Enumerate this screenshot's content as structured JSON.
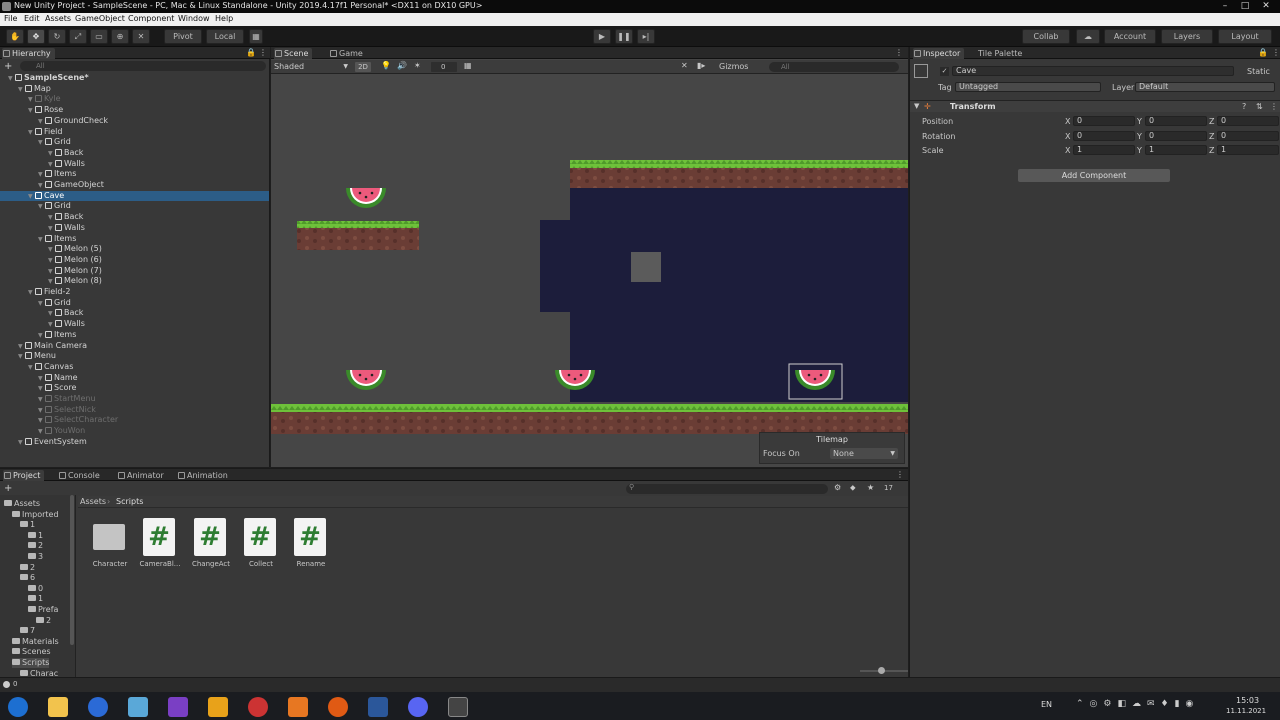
{
  "window": {
    "title": "New Unity Project - SampleScene - PC, Mac & Linux Standalone - Unity 2019.4.17f1 Personal* <DX11 on DX10 GPU>"
  },
  "menu": [
    "File",
    "Edit",
    "Assets",
    "GameObject",
    "Component",
    "Window",
    "Help"
  ],
  "toolbar": {
    "pivot": "Pivot",
    "local": "Local",
    "collab": "Collab",
    "account": "Account",
    "layers": "Layers",
    "layout": "Layout"
  },
  "hierarchy": {
    "tab": "Hierarchy",
    "search_placeholder": "All",
    "rows": [
      {
        "label": "SampleScene*",
        "indent": 0,
        "state": "root"
      },
      {
        "label": "Map",
        "indent": 1,
        "state": ""
      },
      {
        "label": "Kyle",
        "indent": 2,
        "state": "dim"
      },
      {
        "label": "Rose",
        "indent": 2,
        "state": ""
      },
      {
        "label": "GroundCheck",
        "indent": 3,
        "state": ""
      },
      {
        "label": "Field",
        "indent": 2,
        "state": ""
      },
      {
        "label": "Grid",
        "indent": 3,
        "state": ""
      },
      {
        "label": "Back",
        "indent": 4,
        "state": ""
      },
      {
        "label": "Walls",
        "indent": 4,
        "state": ""
      },
      {
        "label": "Items",
        "indent": 3,
        "state": ""
      },
      {
        "label": "GameObject",
        "indent": 3,
        "state": ""
      },
      {
        "label": "Cave",
        "indent": 2,
        "state": "sel"
      },
      {
        "label": "Grid",
        "indent": 3,
        "state": ""
      },
      {
        "label": "Back",
        "indent": 4,
        "state": ""
      },
      {
        "label": "Walls",
        "indent": 4,
        "state": ""
      },
      {
        "label": "Items",
        "indent": 3,
        "state": ""
      },
      {
        "label": "Melon (5)",
        "indent": 4,
        "state": ""
      },
      {
        "label": "Melon (6)",
        "indent": 4,
        "state": ""
      },
      {
        "label": "Melon (7)",
        "indent": 4,
        "state": ""
      },
      {
        "label": "Melon (8)",
        "indent": 4,
        "state": ""
      },
      {
        "label": "Field-2",
        "indent": 2,
        "state": ""
      },
      {
        "label": "Grid",
        "indent": 3,
        "state": ""
      },
      {
        "label": "Back",
        "indent": 4,
        "state": ""
      },
      {
        "label": "Walls",
        "indent": 4,
        "state": ""
      },
      {
        "label": "Items",
        "indent": 3,
        "state": ""
      },
      {
        "label": "Main Camera",
        "indent": 1,
        "state": ""
      },
      {
        "label": "Menu",
        "indent": 1,
        "state": ""
      },
      {
        "label": "Canvas",
        "indent": 2,
        "state": ""
      },
      {
        "label": "Name",
        "indent": 3,
        "state": ""
      },
      {
        "label": "Score",
        "indent": 3,
        "state": ""
      },
      {
        "label": "StartMenu",
        "indent": 3,
        "state": "dim"
      },
      {
        "label": "SelectNick",
        "indent": 3,
        "state": "dim"
      },
      {
        "label": "SelectCharacter",
        "indent": 3,
        "state": "dim"
      },
      {
        "label": "YouWon",
        "indent": 3,
        "state": "dim"
      },
      {
        "label": "EventSystem",
        "indent": 1,
        "state": ""
      }
    ]
  },
  "scene": {
    "tabs": [
      "Scene",
      "Game"
    ],
    "shading": "Shaded",
    "mode_2d": "2D",
    "fx_count": "0",
    "gizmos": "Gizmos",
    "search_placeholder": "All",
    "overlay": {
      "title": "Tilemap",
      "focus_label": "Focus On",
      "focus_value": "None"
    }
  },
  "inspector": {
    "tabs": [
      "Inspector",
      "Tile Palette"
    ],
    "object_name": "Cave",
    "static_label": "Static",
    "tag_label": "Tag",
    "tag_value": "Untagged",
    "layer_label": "Layer",
    "layer_value": "Default",
    "component": "Transform",
    "position": {
      "label": "Position",
      "x": "0",
      "y": "0",
      "z": "0"
    },
    "rotation": {
      "label": "Rotation",
      "x": "0",
      "y": "0",
      "z": "0"
    },
    "scale": {
      "label": "Scale",
      "x": "1",
      "y": "1",
      "z": "1"
    },
    "axis": {
      "x": "X",
      "y": "Y",
      "z": "Z"
    },
    "add_component": "Add Component"
  },
  "project": {
    "tabs": [
      "Project",
      "Console",
      "Animator",
      "Animation"
    ],
    "breadcrumb": {
      "root": "Assets",
      "current": "Scripts"
    },
    "item_count": "17",
    "tree": [
      {
        "label": "Assets",
        "indent": 0
      },
      {
        "label": "Imported",
        "indent": 1
      },
      {
        "label": "1",
        "indent": 2
      },
      {
        "label": "1",
        "indent": 3
      },
      {
        "label": "2",
        "indent": 3
      },
      {
        "label": "3",
        "indent": 3
      },
      {
        "label": "2",
        "indent": 2
      },
      {
        "label": "6",
        "indent": 2
      },
      {
        "label": "0",
        "indent": 3
      },
      {
        "label": "1",
        "indent": 3
      },
      {
        "label": "Prefa",
        "indent": 3
      },
      {
        "label": "2",
        "indent": 4
      },
      {
        "label": "7",
        "indent": 2
      },
      {
        "label": "Materials",
        "indent": 1
      },
      {
        "label": "Scenes",
        "indent": 1
      },
      {
        "label": "Scripts",
        "indent": 1
      },
      {
        "label": "Charac",
        "indent": 2
      }
    ],
    "assets": [
      {
        "label": "Character",
        "kind": "folder"
      },
      {
        "label": "CameraBl...",
        "kind": "script"
      },
      {
        "label": "ChangeAct",
        "kind": "script"
      },
      {
        "label": "Collect",
        "kind": "script"
      },
      {
        "label": "Rename",
        "kind": "script"
      }
    ],
    "hash_glyph": "#"
  },
  "status": {
    "count": "0"
  },
  "taskbar": {
    "lang": "EN",
    "time": "15:03",
    "date": "11.11.2021"
  },
  "colors": {
    "selection": "#2c5d87",
    "cave": "#1c1d3b",
    "grass": "#74c63c",
    "dirt": "#6b3f36"
  }
}
